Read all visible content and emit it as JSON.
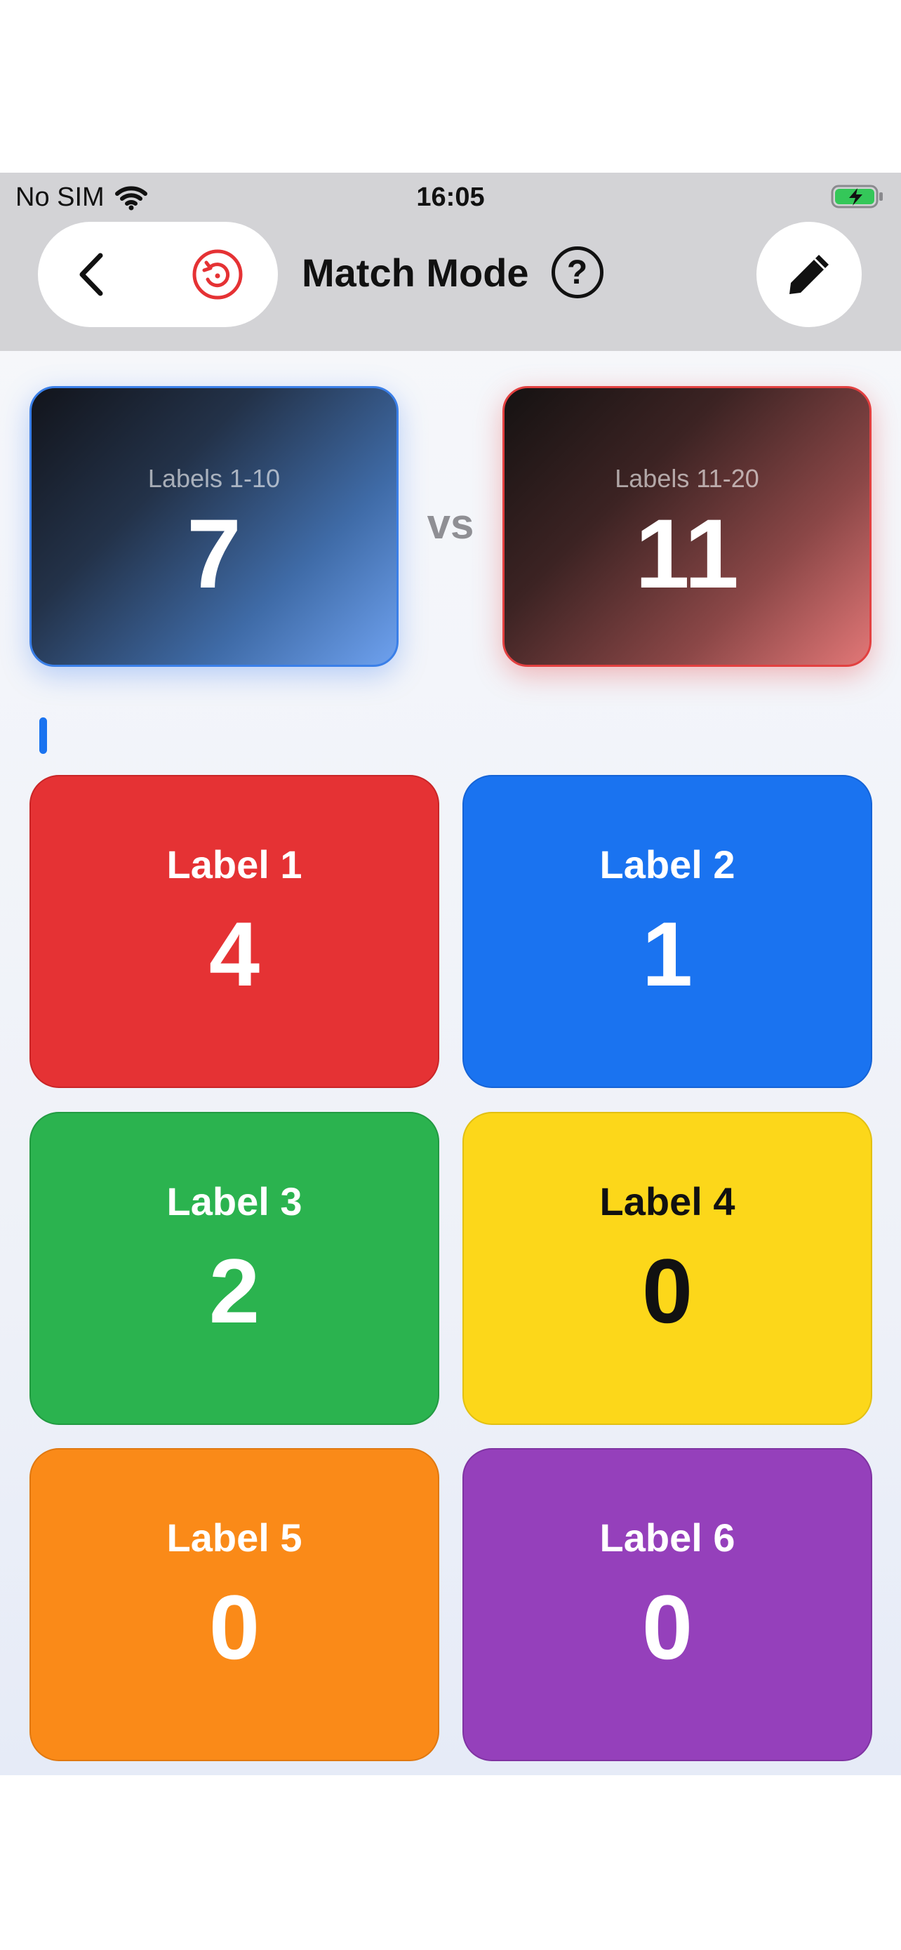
{
  "status_bar": {
    "carrier": "No SIM",
    "time": "16:05",
    "icons": [
      "wifi-icon",
      "battery-charging-icon"
    ]
  },
  "nav": {
    "title": "Match Mode",
    "help_label": "?",
    "icons": {
      "back": "chevron-left-icon",
      "reset": "reset-icon",
      "edit": "pencil-icon"
    },
    "reset_color": "#e53234"
  },
  "match": {
    "team_a": {
      "label": "Labels 1-10",
      "score": "7",
      "accent": "#3a7fe8"
    },
    "vs": "vs",
    "team_b": {
      "label": "Labels 11-20",
      "score": "11",
      "accent": "#e24040"
    }
  },
  "counters": [
    {
      "label": "Label 1",
      "value": "4",
      "color": "#e53234"
    },
    {
      "label": "Label 2",
      "value": "1",
      "color": "#1a73f0"
    },
    {
      "label": "Label 3",
      "value": "2",
      "color": "#2bb34f"
    },
    {
      "label": "Label 4",
      "value": "0",
      "color": "#fcd71a"
    },
    {
      "label": "Label 5",
      "value": "0",
      "color": "#fa8a18"
    },
    {
      "label": "Label 6",
      "value": "0",
      "color": "#9540bb"
    }
  ]
}
